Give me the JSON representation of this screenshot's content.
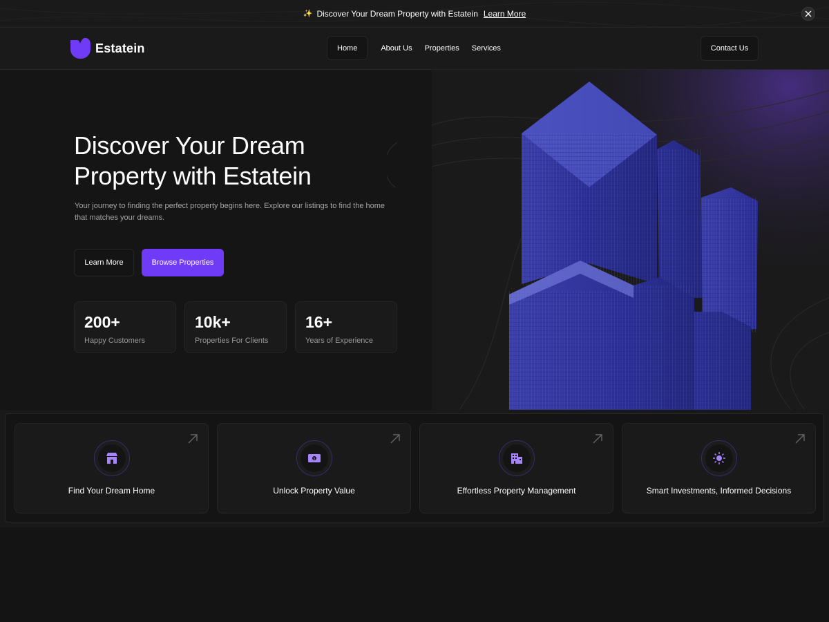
{
  "banner": {
    "text": "Discover Your Dream Property with Estatein",
    "link": "Learn More",
    "sparkle_icon": "sparkle-icon",
    "close_icon": "close-icon"
  },
  "header": {
    "logo_text": "Estatein",
    "nav": [
      {
        "label": "Home",
        "active": true
      },
      {
        "label": "About Us"
      },
      {
        "label": "Properties"
      },
      {
        "label": "Services"
      }
    ],
    "contact": "Contact Us"
  },
  "hero": {
    "title": "Discover Your Dream Property with Estatein",
    "description": "Your journey to finding the perfect property begins here. Explore our listings to find the home that matches your dreams.",
    "btn_learn": "Learn More",
    "btn_browse": "Browse Properties",
    "stats": [
      {
        "value": "200+",
        "label": "Happy Customers"
      },
      {
        "value": "10k+",
        "label": "Properties For Clients"
      },
      {
        "value": "16+",
        "label": "Years of Experience"
      }
    ]
  },
  "features": [
    {
      "title": "Find Your Dream Home",
      "icon": "storefront-icon"
    },
    {
      "title": "Unlock Property Value",
      "icon": "money-icon"
    },
    {
      "title": "Effortless Property Management",
      "icon": "buildings-icon"
    },
    {
      "title": "Smart Investments, Informed Decisions",
      "icon": "sun-icon"
    }
  ],
  "colors": {
    "accent": "#703bf7",
    "background": "#141414",
    "surface": "#1a1a1a",
    "border": "#262626"
  }
}
